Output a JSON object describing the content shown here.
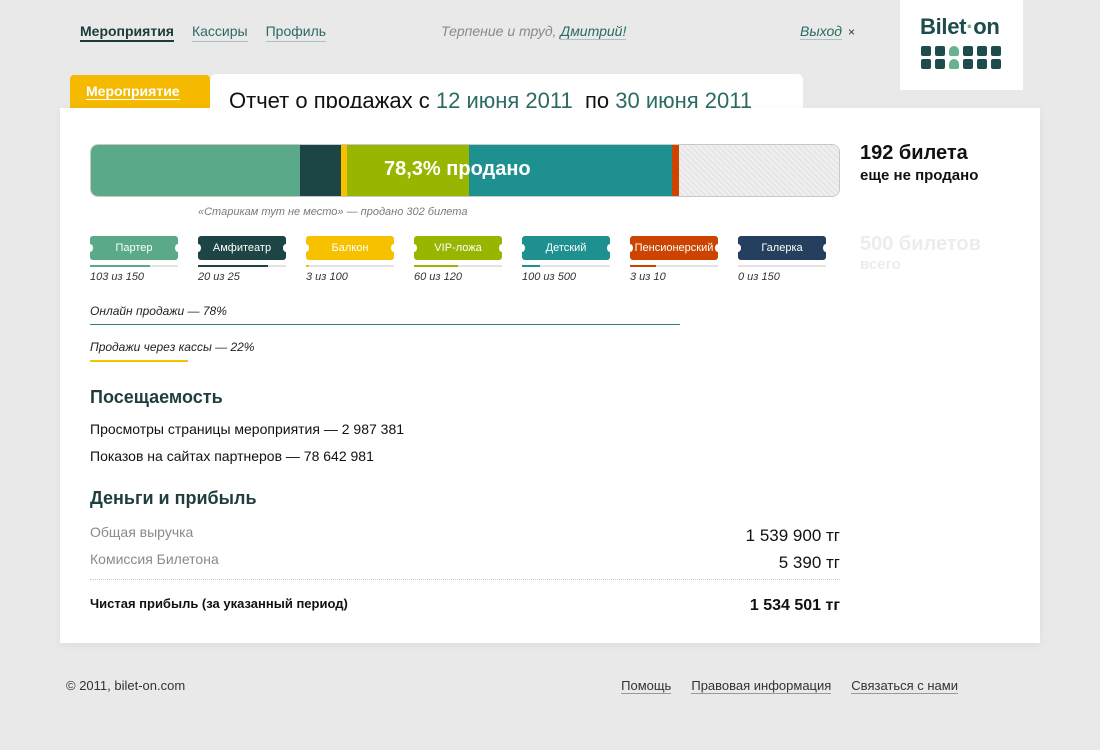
{
  "nav": {
    "items": [
      {
        "label": "Мероприятия",
        "active": true
      },
      {
        "label": "Кассиры",
        "active": false
      },
      {
        "label": "Профиль",
        "active": false
      }
    ],
    "greeting_text": "Терпение и труд,",
    "user_name": "Дмитрий!",
    "logout_label": "Выход",
    "logout_close": "×"
  },
  "logo": {
    "text_a": "Bilet",
    "text_dot": "·",
    "text_b": "on"
  },
  "tabs": {
    "event_label": "Мероприятие",
    "report_prefix": "Отчет о продажах с",
    "date_from": "12 июня 2011",
    "report_middle": "по",
    "date_to": "30 июня 2011"
  },
  "sales": {
    "sold_label": "78,3% продано",
    "sold_fraction": 0.783,
    "note": "«Старикам тут не место» — продано 302 билета",
    "unsold_count": "192 билета",
    "unsold_text": "еще не продано",
    "total_count": "500 билетов",
    "total_text": "всего"
  },
  "categories": [
    {
      "name": "Партер",
      "count": "103 из 150",
      "sold": 103,
      "total": 150,
      "color": "#5aaa8a"
    },
    {
      "name": "Амфитеатр",
      "count": "20 из 25",
      "sold": 20,
      "total": 25,
      "color": "#1e4546"
    },
    {
      "name": "Балкон",
      "count": "3 из 100",
      "sold": 3,
      "total": 100,
      "color": "#f7c100"
    },
    {
      "name": "VIP-ложа",
      "count": "60 из 120",
      "sold": 60,
      "total": 120,
      "color": "#98b600"
    },
    {
      "name": "Детский",
      "count": "100 из 500",
      "sold": 100,
      "total": 500,
      "color": "#1e9090"
    },
    {
      "name": "Пенсионерский",
      "count": "3 из 10",
      "sold": 3,
      "total": 10,
      "color": "#cd4300"
    },
    {
      "name": "Галерка",
      "count": "0 из 150",
      "sold": 0,
      "total": 150,
      "color": "#253f5e"
    }
  ],
  "channels": {
    "online": "Онлайн продажи — 78%",
    "box_office": "Продажи через кассы — 22%"
  },
  "attendance": {
    "title": "Посещаемость",
    "views": "Просмотры страницы мероприятия — 2 987 381",
    "impressions": "Показов на сайтах партнеров — 78 642 981"
  },
  "money": {
    "title": "Деньги и прибыль",
    "revenue_label": "Общая выручка",
    "revenue_value": "1 539 900 тг",
    "commission_label": "Комиссия Билетона",
    "commission_value": "5 390 тг",
    "net_label": "Чистая прибыль (за указанный период)",
    "net_value": "1 534 501 тг"
  },
  "footer": {
    "copyright": "© 2011, bilet-on.com",
    "links": [
      "Помощь",
      "Правовая информация",
      "Связаться с нами"
    ]
  }
}
